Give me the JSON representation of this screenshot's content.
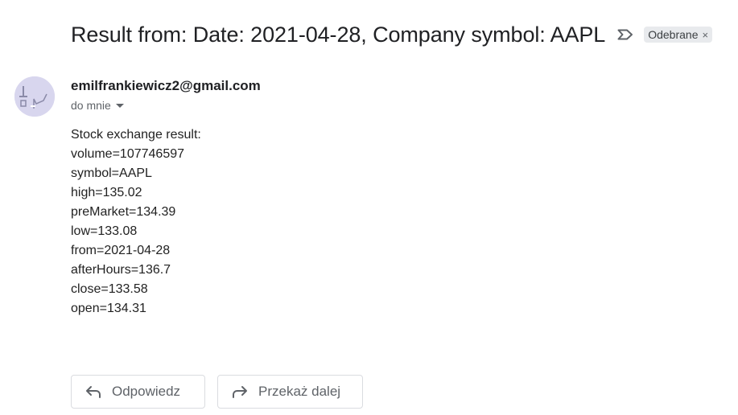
{
  "email": {
    "subject": "Result from: Date: 2021-04-28, Company symbol: AAPL",
    "importance_icon": "importance-marker-icon",
    "label": {
      "text": "Odebrane",
      "close_glyph": "×"
    },
    "sender": "emilfrankiewicz2@gmail.com",
    "recipient": "do mnie",
    "body_lines": [
      "Stock exchange result:",
      "volume=107746597",
      "symbol=AAPL",
      "high=135.02",
      "preMarket=134.39",
      "low=133.08",
      "from=2021-04-28",
      "afterHours=136.7",
      "close=133.58",
      "open=134.31"
    ]
  },
  "actions": {
    "reply_label": "Odpowiedz",
    "forward_label": "Przekaż dalej"
  },
  "colors": {
    "chip_bg": "#e8eaed",
    "avatar_bg": "#d8d6ee",
    "button_border": "#dadce0",
    "secondary_text": "#5f6368"
  }
}
